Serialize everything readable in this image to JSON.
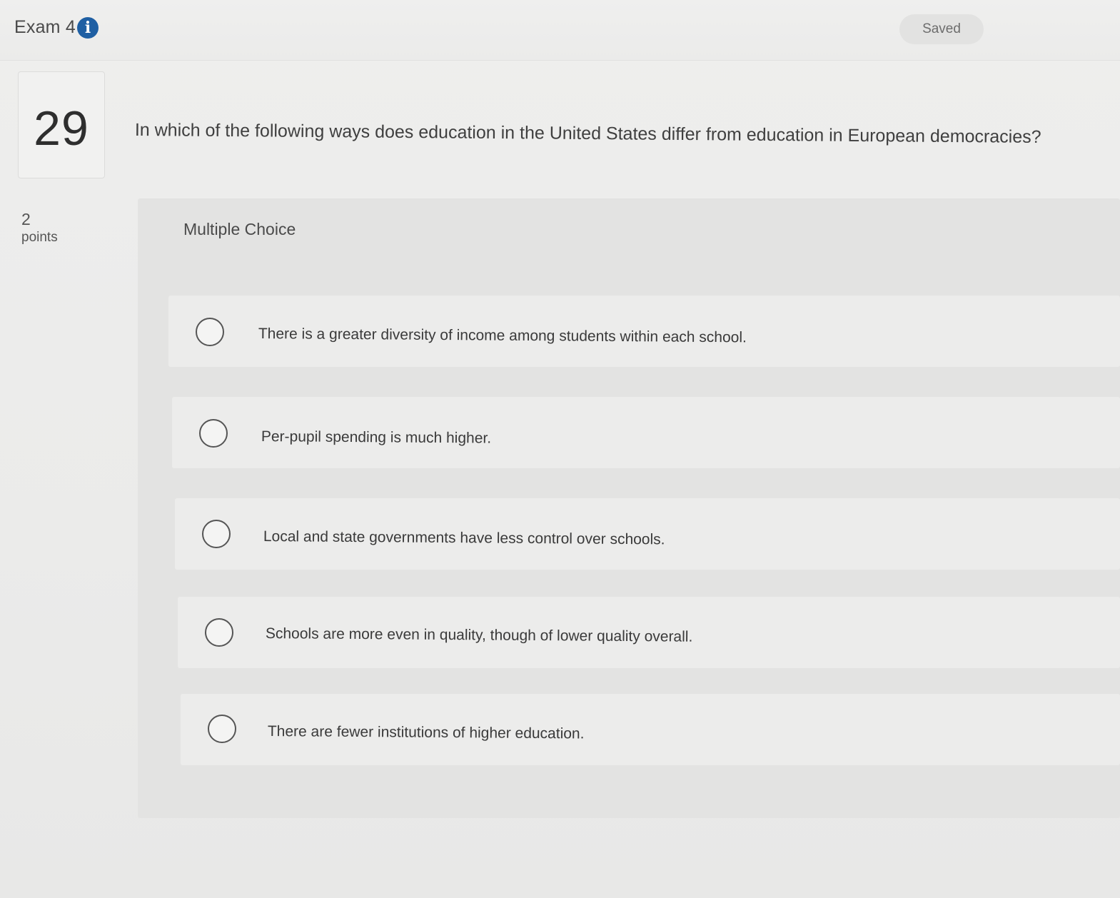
{
  "header": {
    "exam_title": "Exam 4",
    "info_icon": "info-circle-icon",
    "status": "Saved"
  },
  "question": {
    "number": "29",
    "text": "In which of the following ways does education in the United States differ from education in European democracies?",
    "points_value": "2",
    "points_label": "points",
    "type_label": "Multiple Choice"
  },
  "options": [
    {
      "label": "There is a greater diversity of income among students within each school."
    },
    {
      "label": "Per-pupil spending is much higher."
    },
    {
      "label": "Local and state governments have less control over schools."
    },
    {
      "label": "Schools are more even in quality, though of lower quality overall."
    },
    {
      "label": "There are fewer institutions of higher education."
    }
  ],
  "colors": {
    "info_icon": "#1f5fa3",
    "background": "#ececeb",
    "panel": "#e3e3e2"
  }
}
